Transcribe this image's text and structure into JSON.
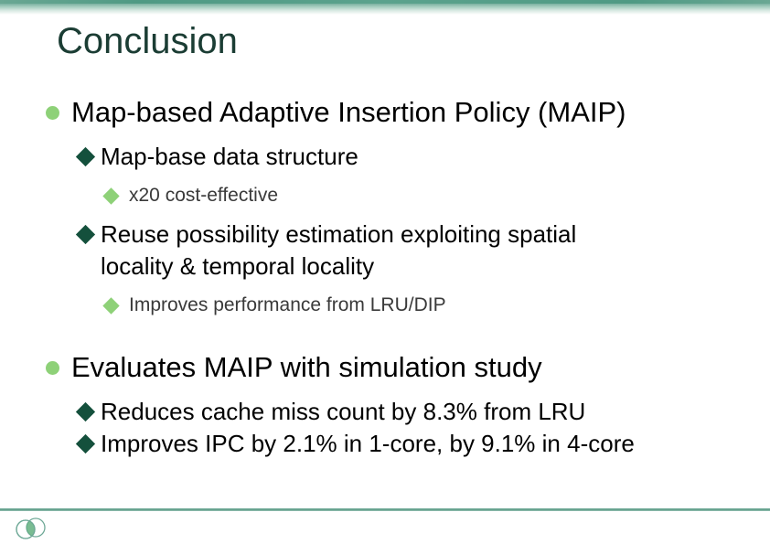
{
  "slide": {
    "title": "Conclusion",
    "theme": {
      "title_color": "#1b3d34",
      "accent_band_color": "#5a9e8a",
      "bullet_level1_color": "#8ed178",
      "bullet_level2_color": "#14503c",
      "bullet_level3_color": "#8ed178",
      "body_text_color": "#000000",
      "sub_text_color": "#3a3a3a",
      "footer_rule_color": "#5d9c88",
      "background_color": "#ffffff"
    },
    "bullets": [
      {
        "level": 1,
        "marker": "circle-bullet-icon",
        "text": "Map-based Adaptive Insertion Policy (MAIP)"
      },
      {
        "level": 2,
        "marker": "diamond-bullet-dark-icon",
        "text": "Map-base data structure"
      },
      {
        "level": 3,
        "marker": "diamond-bullet-light-icon",
        "text": "x20 cost-effective"
      },
      {
        "level": 2,
        "marker": "diamond-bullet-dark-icon",
        "text": "Reuse possibility estimation exploiting spatial locality & temporal locality"
      },
      {
        "level": 3,
        "marker": "diamond-bullet-light-icon",
        "text": "Improves performance from LRU/DIP"
      },
      {
        "level": 1,
        "marker": "circle-bullet-icon",
        "text": "Evaluates MAIP with simulation study"
      },
      {
        "level": 2,
        "marker": "diamond-bullet-dark-icon",
        "text": "Reduces cache miss count by 8.3% from LRU"
      },
      {
        "level": 2,
        "marker": "diamond-bullet-dark-icon",
        "text": "Improves IPC by 2.1% in 1-core, by 9.1% in 4-core"
      }
    ],
    "footer": {
      "logo_name": "overlapping-circles-logo"
    }
  }
}
